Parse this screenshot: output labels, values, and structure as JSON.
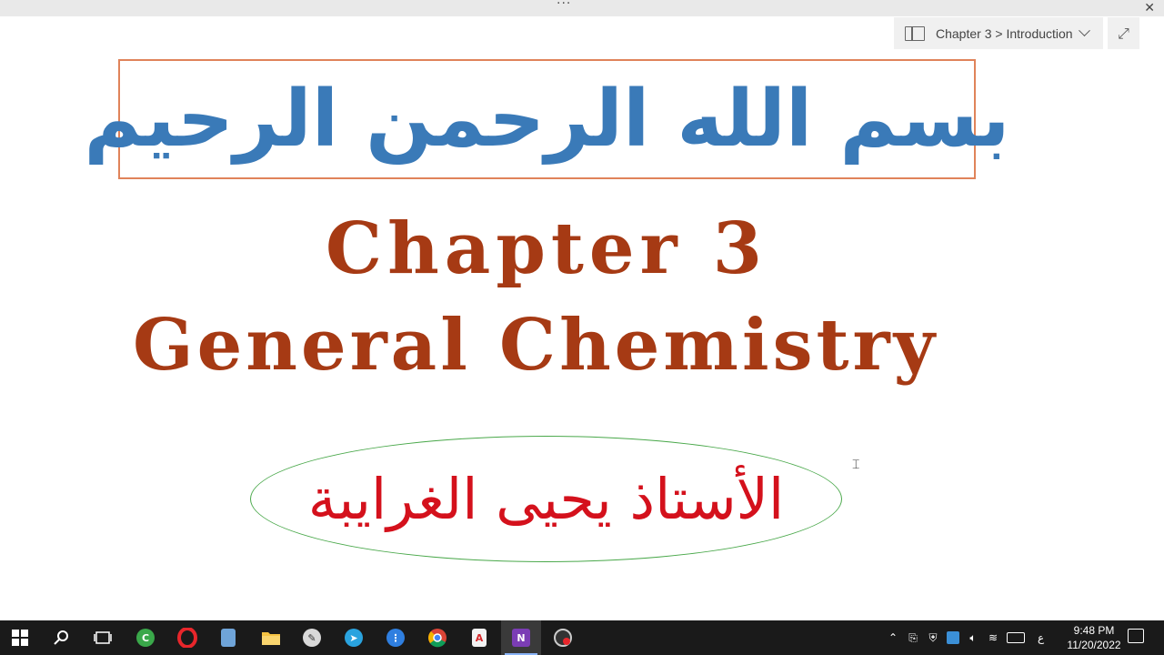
{
  "topbar": {
    "dots": "···",
    "close": "✕"
  },
  "nav": {
    "breadcrumb": "Chapter 3 > Introduction",
    "expand": "⤢"
  },
  "slide": {
    "basmala": "بسم الله الرحمن الرحيم",
    "title_line1": "Chapter 3",
    "title_line2": "General Chemistry",
    "teacher": "الأستاذ يحيى الغرايبة"
  },
  "taskbar": {
    "icons": [
      "windows-start-icon",
      "search-icon",
      "task-view-icon",
      "codeblocks-icon",
      "opera-icon",
      "notepad-icon",
      "file-explorer-icon",
      "paint-icon",
      "telegram-icon",
      "app-icon",
      "chrome-icon",
      "pdf-icon",
      "onenote-icon",
      "screen-recorder-icon"
    ],
    "tray_lang": "ع",
    "time": "9:48 PM",
    "date": "11/20/2022"
  },
  "colors": {
    "basmala": "#3a7ab8",
    "title": "#a63a14",
    "teacher": "#d4111c",
    "box_border": "#e0835a",
    "ellipse_border": "#49a84a"
  }
}
